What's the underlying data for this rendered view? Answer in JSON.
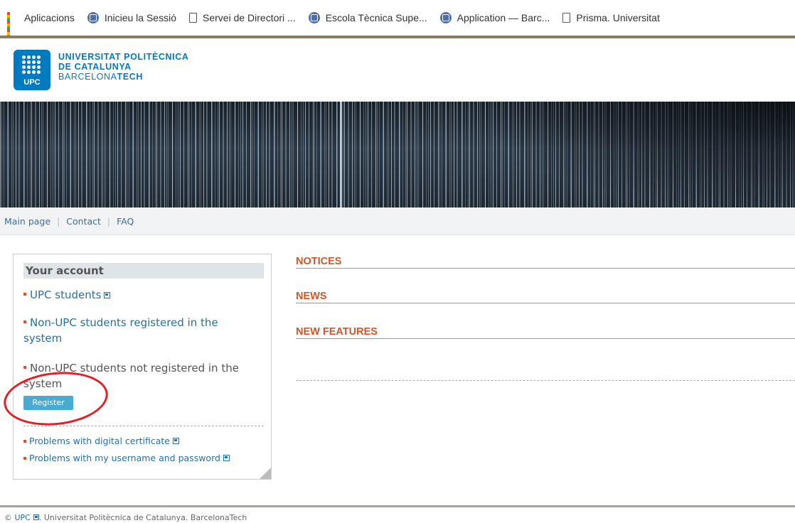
{
  "bookmarks": [
    {
      "label": "Aplicacions",
      "icon": "apps-grid-icon"
    },
    {
      "label": "Inicieu la Sessió",
      "icon": "globe-icon"
    },
    {
      "label": "Servei de Directori ...",
      "icon": "document-icon"
    },
    {
      "label": "Escola Tècnica Supe...",
      "icon": "globe-icon"
    },
    {
      "label": "Application — Barc...",
      "icon": "globe-icon"
    },
    {
      "label": "Prisma. Universitat",
      "icon": "document-icon"
    }
  ],
  "header": {
    "logo_text": "UPC",
    "line1": "UNIVERSITAT POLITÈCNICA",
    "line2": "DE CATALUNYA",
    "line3a": "BARCELONA",
    "line3b": "TECH"
  },
  "nav": {
    "items": [
      "Main page",
      "Contact",
      "FAQ"
    ],
    "separator": "|"
  },
  "account": {
    "title": "Your account",
    "upc_students": "UPC students",
    "registered": "Non-UPC students registered in the",
    "registered2": "system",
    "not_registered": "Non-UPC students not registered in the",
    "not_registered2": "system",
    "register_button": "Register",
    "problem_cert": "Problems with digital certificate",
    "problem_login": "Problems with my username and password"
  },
  "sections": {
    "notices": "NOTICES",
    "news": "NEWS",
    "new_features": "NEW FEATURES"
  },
  "footer": {
    "prefix": "©",
    "link": "UPC",
    "text": ". Universitat Politècnica de Catalunya. BarcelonaTech"
  },
  "colors": {
    "brand": "#007bc0",
    "section_heading": "#d0562a",
    "link": "#2b6f9e",
    "register_button": "#4aabd2",
    "annotation_circle": "#e21f26"
  }
}
